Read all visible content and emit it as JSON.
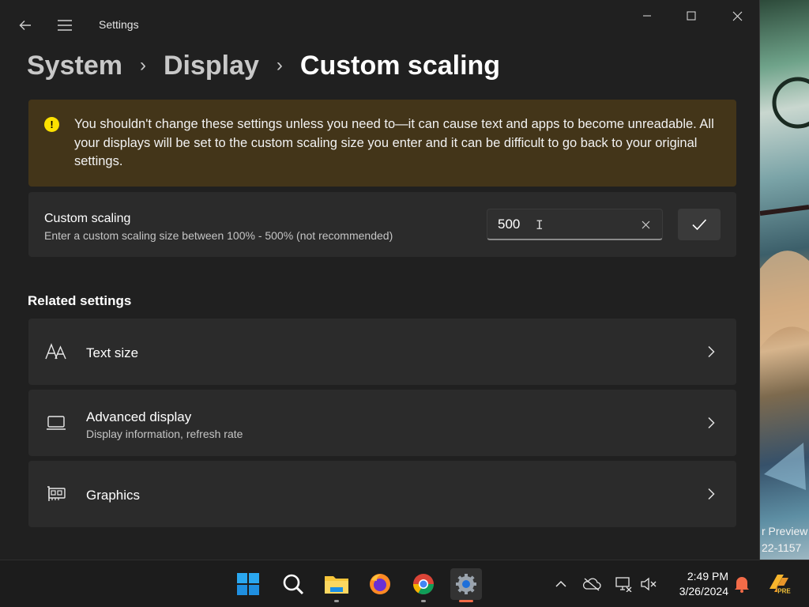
{
  "window": {
    "title": "Settings",
    "controls": {
      "minimize": "minimize",
      "maximize": "maximize",
      "close": "close"
    }
  },
  "breadcrumb": {
    "items": [
      "System",
      "Display"
    ],
    "current": "Custom scaling"
  },
  "warning": {
    "text": "You shouldn't change these settings unless you need to—it can cause text and apps to become unreadable. All your displays will be set to the custom scaling size you enter and it can be difficult to go back to your original settings."
  },
  "custom_scaling": {
    "title": "Custom scaling",
    "description": "Enter a custom scaling size between 100% - 500% (not recommended)",
    "value": "500"
  },
  "related": {
    "title": "Related settings",
    "items": [
      {
        "title": "Text size",
        "icon": "text-size-icon"
      },
      {
        "title": "Advanced display",
        "subtitle": "Display information, refresh rate",
        "icon": "monitor-icon"
      },
      {
        "title": "Graphics",
        "icon": "graphics-card-icon"
      }
    ]
  },
  "wallpaper": {
    "text1": "r Preview",
    "text2": "22-1157"
  },
  "taskbar": {
    "apps": [
      "start",
      "search",
      "file-explorer",
      "firefox",
      "chrome",
      "settings"
    ],
    "time": "2:49 PM",
    "date": "3/26/2024"
  },
  "colors": {
    "warning_bg": "#433519",
    "warning_icon": "#fce100",
    "card_bg": "#2b2b2b",
    "window_bg": "#202020",
    "accent": "#f26b48"
  }
}
